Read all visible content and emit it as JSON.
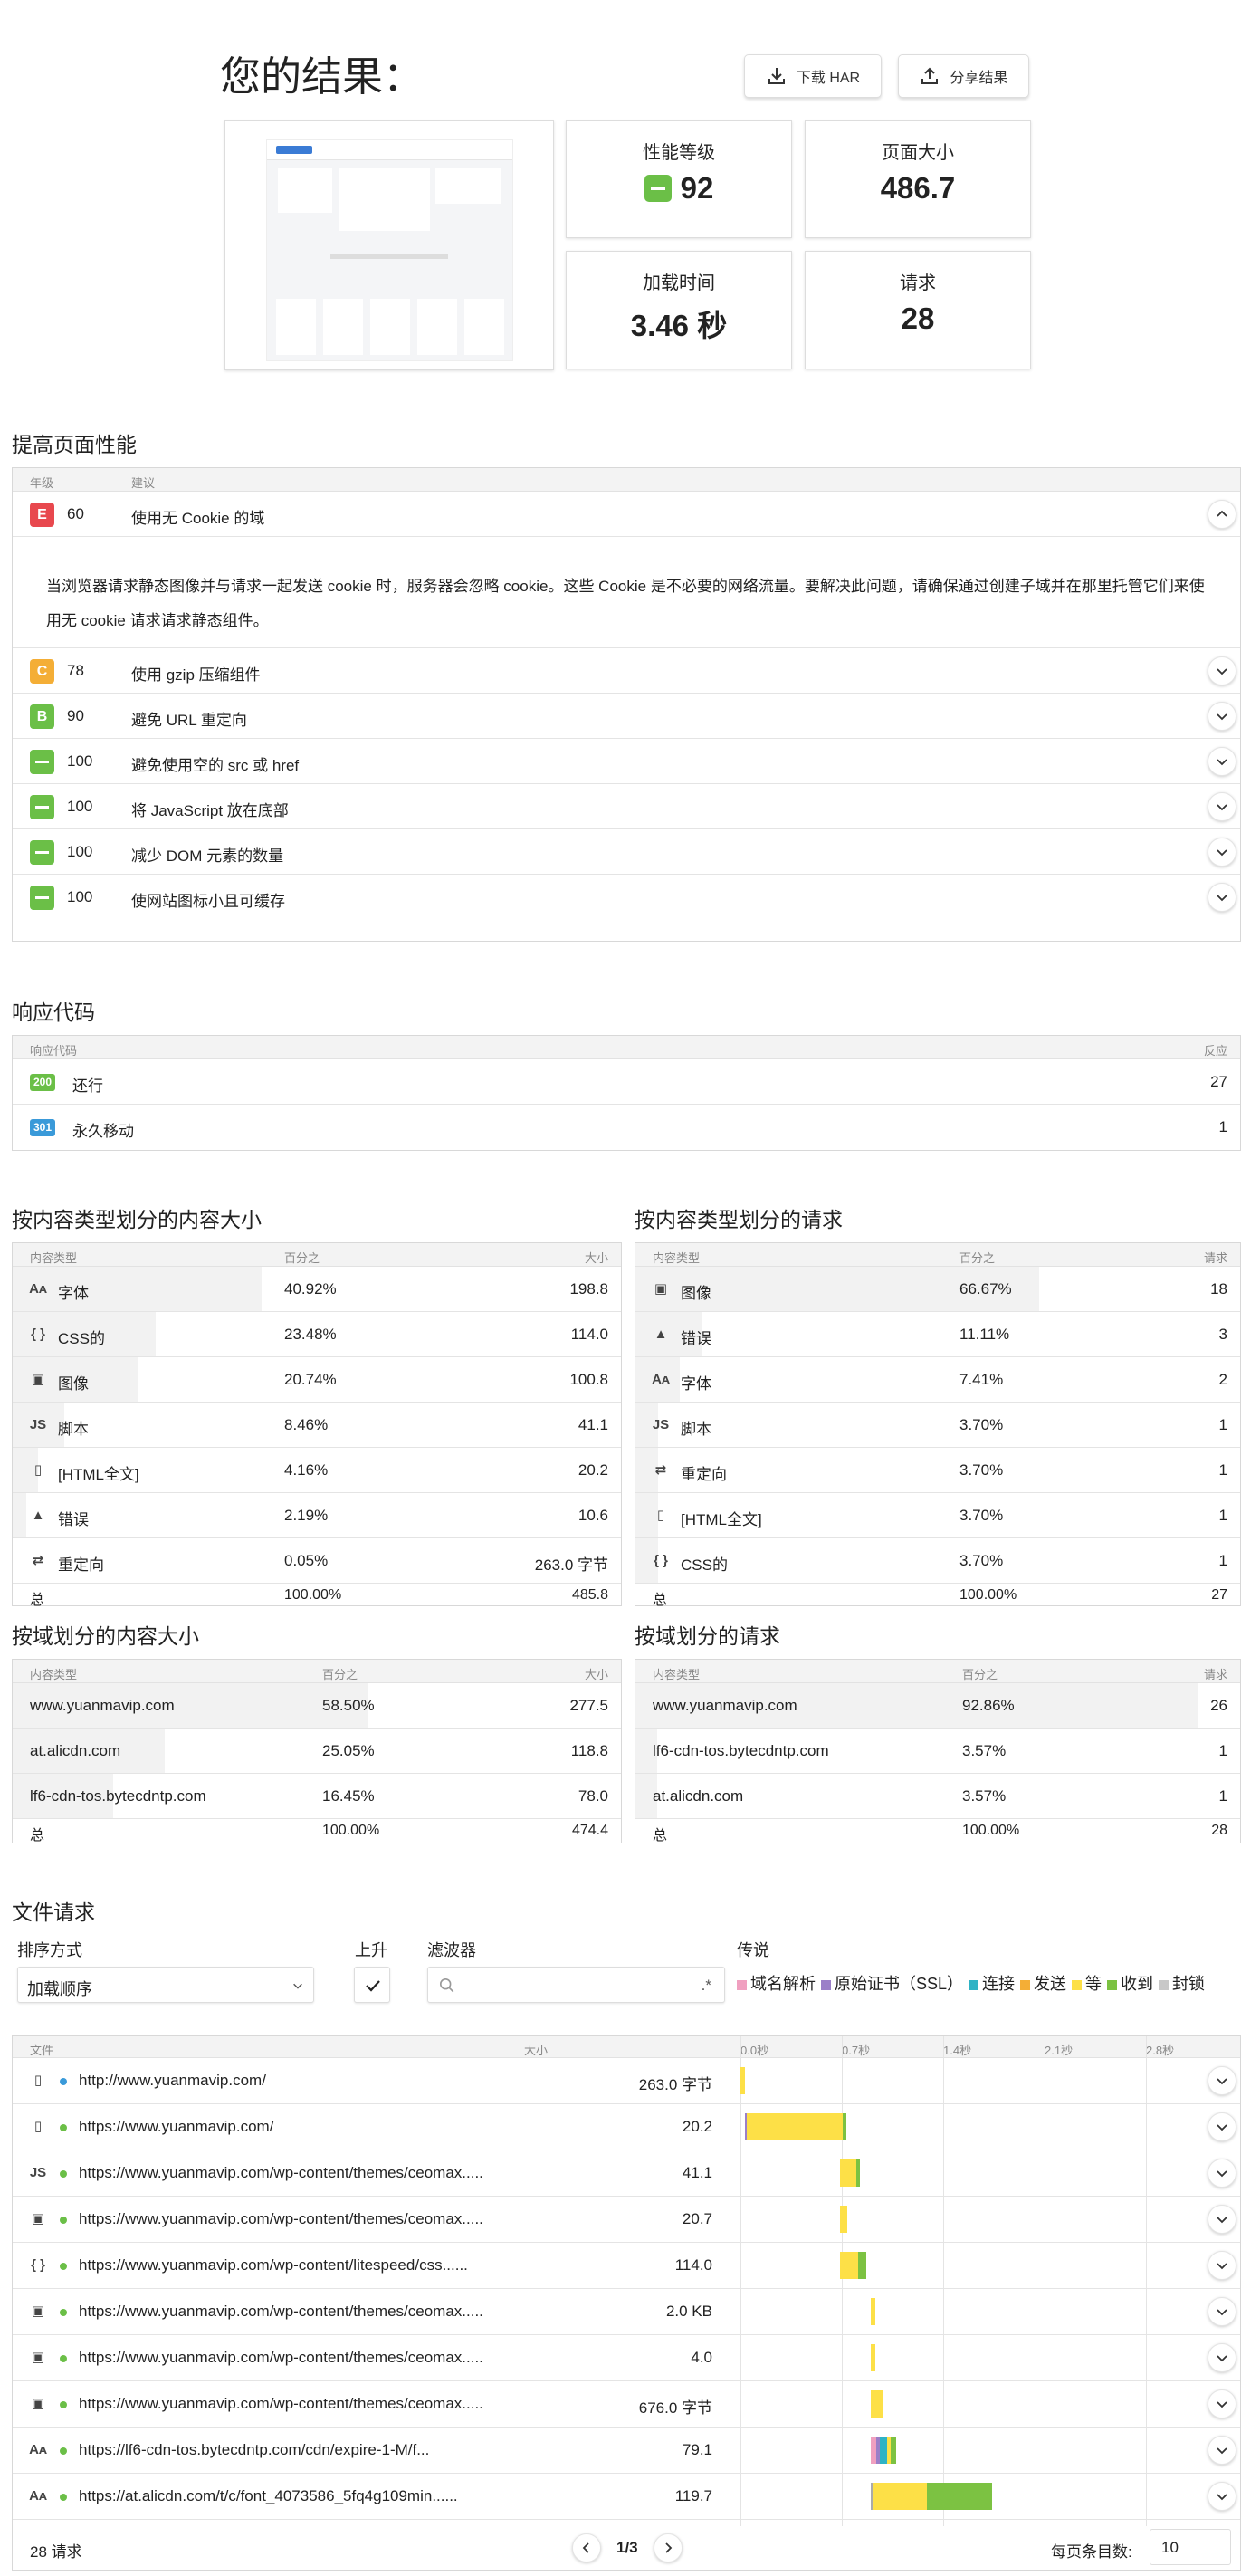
{
  "header": {
    "title": "您的结果：",
    "download_har": "下载 HAR",
    "share": "分享结果"
  },
  "summary": {
    "grade_label": "性能等级",
    "grade_value": "92",
    "size_label": "页面大小",
    "size_value": "486.7",
    "load_label": "加载时间",
    "load_value": "3.46 秒",
    "req_label": "请求",
    "req_value": "28"
  },
  "improve": {
    "title": "提高页面性能",
    "col_grade": "年级",
    "col_advice": "建议",
    "expanded_text": "当浏览器请求静态图像并与请求一起发送 cookie 时，服务器会忽略 cookie。这些 Cookie 是不必要的网络流量。要解决此问题，请确保通过创建子域并在那里托管它们来使用无 cookie 请求请求静态组件。",
    "items": [
      {
        "grade": "E",
        "score": "60",
        "text": "使用无 Cookie 的域"
      },
      {
        "grade": "C",
        "score": "78",
        "text": "使用 gzip 压缩组件"
      },
      {
        "grade": "B",
        "score": "90",
        "text": "避免 URL 重定向"
      },
      {
        "grade": "A",
        "score": "100",
        "text": "避免使用空的 src 或 href"
      },
      {
        "grade": "A",
        "score": "100",
        "text": "将 JavaScript 放在底部"
      },
      {
        "grade": "A",
        "score": "100",
        "text": "减少 DOM 元素的数量"
      },
      {
        "grade": "A",
        "score": "100",
        "text": "使网站图标小且可缓存"
      }
    ]
  },
  "codes": {
    "title": "响应代码",
    "col_code": "响应代码",
    "col_count": "反应",
    "items": [
      {
        "code": "200",
        "text": "还行",
        "count": "27",
        "color": "#6bbf47"
      },
      {
        "code": "301",
        "text": "永久移动",
        "count": "1",
        "color": "#3a9ad9"
      }
    ]
  },
  "size_by_type": {
    "title": "按内容类型划分的内容大小",
    "col_type": "内容类型",
    "col_pct": "百分之",
    "col_size": "大小",
    "rows": [
      {
        "icon": "font-icon",
        "glyph": "Aᴀ",
        "name": "字体",
        "pct": "40.92%",
        "val": "198.8",
        "frac": 0.409
      },
      {
        "icon": "css-icon",
        "glyph": "{ }",
        "name": "CSS的",
        "pct": "23.48%",
        "val": "114.0",
        "frac": 0.235
      },
      {
        "icon": "image-icon",
        "glyph": "▣",
        "name": "图像",
        "pct": "20.74%",
        "val": "100.8",
        "frac": 0.207
      },
      {
        "icon": "script-icon",
        "glyph": "JS",
        "name": "脚本",
        "pct": "8.46%",
        "val": "41.1",
        "frac": 0.085
      },
      {
        "icon": "html-icon",
        "glyph": "▯",
        "name": "[HTML全文]",
        "pct": "4.16%",
        "val": "20.2",
        "frac": 0.042
      },
      {
        "icon": "error-icon",
        "glyph": "▲",
        "name": "错误",
        "pct": "2.19%",
        "val": "10.6",
        "frac": 0.022
      },
      {
        "icon": "redirect-icon",
        "glyph": "⇄",
        "name": "重定向",
        "pct": "0.05%",
        "val": "263.0 字节",
        "frac": 0.0005
      }
    ],
    "total": {
      "name": "总",
      "pct": "100.00%",
      "val": "485.8"
    }
  },
  "req_by_type": {
    "title": "按内容类型划分的请求",
    "col_type": "内容类型",
    "col_pct": "百分之",
    "col_count": "请求",
    "rows": [
      {
        "icon": "image-icon",
        "glyph": "▣",
        "name": "图像",
        "pct": "66.67%",
        "val": "18",
        "frac": 0.667
      },
      {
        "icon": "error-icon",
        "glyph": "▲",
        "name": "错误",
        "pct": "11.11%",
        "val": "3",
        "frac": 0.111
      },
      {
        "icon": "font-icon",
        "glyph": "Aᴀ",
        "name": "字体",
        "pct": "7.41%",
        "val": "2",
        "frac": 0.074
      },
      {
        "icon": "script-icon",
        "glyph": "JS",
        "name": "脚本",
        "pct": "3.70%",
        "val": "1",
        "frac": 0.037
      },
      {
        "icon": "redirect-icon",
        "glyph": "⇄",
        "name": "重定向",
        "pct": "3.70%",
        "val": "1",
        "frac": 0.037
      },
      {
        "icon": "html-icon",
        "glyph": "▯",
        "name": "[HTML全文]",
        "pct": "3.70%",
        "val": "1",
        "frac": 0.037
      },
      {
        "icon": "css-icon",
        "glyph": "{ }",
        "name": "CSS的",
        "pct": "3.70%",
        "val": "1",
        "frac": 0.037
      }
    ],
    "total": {
      "name": "总",
      "pct": "100.00%",
      "val": "27"
    }
  },
  "size_by_domain": {
    "title": "按域划分的内容大小",
    "col_type": "内容类型",
    "col_pct": "百分之",
    "col_size": "大小",
    "rows": [
      {
        "name": "www.yuanmavip.com",
        "pct": "58.50%",
        "val": "277.5",
        "frac": 0.585
      },
      {
        "name": "at.alicdn.com",
        "pct": "25.05%",
        "val": "118.8",
        "frac": 0.25
      },
      {
        "name": "lf6-cdn-tos.bytecdntp.com",
        "pct": "16.45%",
        "val": "78.0",
        "frac": 0.165
      }
    ],
    "total": {
      "name": "总",
      "pct": "100.00%",
      "val": "474.4"
    }
  },
  "req_by_domain": {
    "title": "按域划分的请求",
    "col_type": "内容类型",
    "col_pct": "百分之",
    "col_count": "请求",
    "rows": [
      {
        "name": "www.yuanmavip.com",
        "pct": "92.86%",
        "val": "26",
        "frac": 0.929
      },
      {
        "name": "lf6-cdn-tos.bytecdntp.com",
        "pct": "3.57%",
        "val": "1",
        "frac": 0.036
      },
      {
        "name": "at.alicdn.com",
        "pct": "3.57%",
        "val": "1",
        "frac": 0.036
      }
    ],
    "total": {
      "name": "总",
      "pct": "100.00%",
      "val": "28"
    }
  },
  "files": {
    "title": "文件请求",
    "sort_label": "排序方式",
    "sort_value": "加载顺序",
    "asc_label": "上升",
    "filter_label": "滤波器",
    "filter_placeholder": ".*",
    "legend_label": "传说",
    "legend": [
      {
        "name": "域名解析",
        "color": "#f0a0c0"
      },
      {
        "name": "原始证书（SSL）",
        "color": "#9b7fc8"
      },
      {
        "name": "连接",
        "color": "#2fb3c5"
      },
      {
        "name": "发送",
        "color": "#f4ae36"
      },
      {
        "name": "等",
        "color": "#fde047"
      },
      {
        "name": "收到",
        "color": "#7cc242"
      },
      {
        "name": "封锁",
        "color": "#c8c8c8"
      }
    ],
    "col_file": "文件",
    "col_size": "大小",
    "ticks": [
      "0.0秒",
      "0.7秒",
      "1.4秒",
      "2.1秒",
      "2.8秒"
    ],
    "rows": [
      {
        "icon": "html-icon",
        "glyph": "▯",
        "dot": "#3a9ad9",
        "url": "http://www.yuanmavip.com/",
        "size": "263.0 字节",
        "segs": [
          [
            0.0,
            0.06,
            "#fde047"
          ]
        ]
      },
      {
        "icon": "html-icon",
        "glyph": "▯",
        "dot": "#6bbf47",
        "url": "https://www.yuanmavip.com/",
        "size": "20.2",
        "segs": [
          [
            0.06,
            0.03,
            "#9b7fc8"
          ],
          [
            0.09,
            1.32,
            "#fde047"
          ],
          [
            1.41,
            0.05,
            "#7cc242"
          ]
        ]
      },
      {
        "icon": "script-icon",
        "glyph": "JS",
        "dot": "#6bbf47",
        "url": "https://www.yuanmavip.com/wp-content/themes/ceomax.....",
        "size": "41.1",
        "segs": [
          [
            1.38,
            0.22,
            "#fde047"
          ],
          [
            1.6,
            0.04,
            "#7cc242"
          ]
        ]
      },
      {
        "icon": "image-icon",
        "glyph": "▣",
        "dot": "#6bbf47",
        "url": "https://www.yuanmavip.com/wp-content/themes/ceomax.....",
        "size": "20.7",
        "segs": [
          [
            1.38,
            0.09,
            "#fde047"
          ]
        ]
      },
      {
        "icon": "css-icon",
        "glyph": "{ }",
        "dot": "#6bbf47",
        "url": "https://www.yuanmavip.com/wp-content/litespeed/css......",
        "size": "114.0",
        "segs": [
          [
            1.38,
            0.24,
            "#fde047"
          ],
          [
            1.62,
            0.12,
            "#7cc242"
          ]
        ]
      },
      {
        "icon": "image-icon",
        "glyph": "▣",
        "dot": "#6bbf47",
        "url": "https://www.yuanmavip.com/wp-content/themes/ceomax.....",
        "size": "2.0 KB",
        "segs": [
          [
            1.8,
            0.06,
            "#fde047"
          ]
        ]
      },
      {
        "icon": "image-icon",
        "glyph": "▣",
        "dot": "#6bbf47",
        "url": "https://www.yuanmavip.com/wp-content/themes/ceomax.....",
        "size": "4.0",
        "segs": [
          [
            1.8,
            0.06,
            "#fde047"
          ]
        ]
      },
      {
        "icon": "image-icon",
        "glyph": "▣",
        "dot": "#6bbf47",
        "url": "https://www.yuanmavip.com/wp-content/themes/ceomax.....",
        "size": "676.0 字节",
        "segs": [
          [
            1.8,
            0.18,
            "#fde047"
          ]
        ]
      },
      {
        "icon": "font-icon",
        "glyph": "Aᴀ",
        "dot": "#6bbf47",
        "url": "https://lf6-cdn-tos.bytecdntp.com/cdn/expire-1-M/f...",
        "size": "79.1",
        "segs": [
          [
            1.8,
            0.08,
            "#f0a0c0"
          ],
          [
            1.88,
            0.04,
            "#9b7fc8"
          ],
          [
            1.92,
            0.1,
            "#2fb3c5"
          ],
          [
            2.02,
            0.06,
            "#fde047"
          ],
          [
            2.08,
            0.07,
            "#7cc242"
          ]
        ]
      },
      {
        "icon": "font-icon",
        "glyph": "Aᴀ",
        "dot": "#6bbf47",
        "url": "https://at.alicdn.com/t/c/font_4073586_5fq4g109min......",
        "size": "119.7",
        "segs": [
          [
            1.8,
            0.03,
            "#aaaaaa"
          ],
          [
            1.83,
            0.74,
            "#fde047"
          ],
          [
            2.57,
            0.9,
            "#7cc242"
          ]
        ]
      }
    ],
    "footer": {
      "count": "28 请求",
      "page": "1/3",
      "per_page_label": "每页条目数:",
      "per_page_value": "10"
    }
  }
}
